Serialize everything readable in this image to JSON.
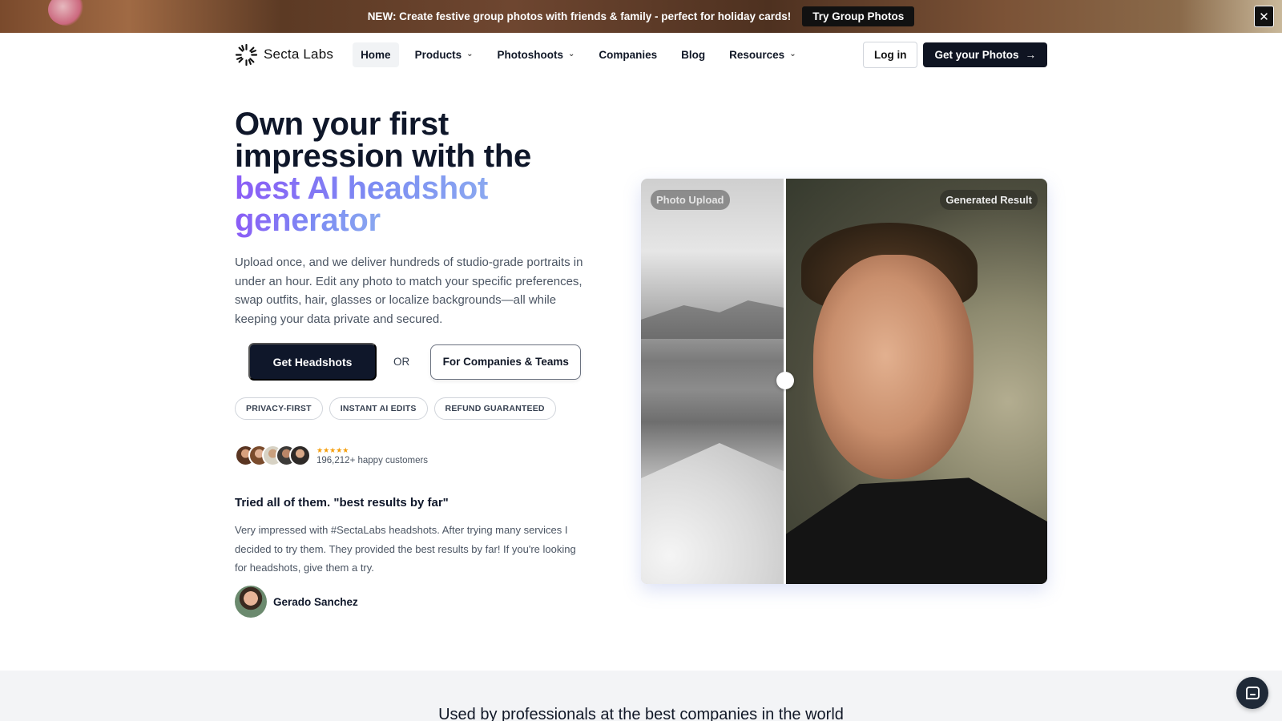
{
  "banner": {
    "text": "NEW: Create festive group photos with friends & family - perfect for holiday cards!",
    "button": "Try Group Photos",
    "close_glyph": "✕"
  },
  "nav": {
    "brand": "Secta Labs",
    "items": [
      {
        "label": "Home",
        "active": true,
        "dropdown": false
      },
      {
        "label": "Products",
        "dropdown": true
      },
      {
        "label": "Photoshoots",
        "dropdown": true
      },
      {
        "label": "Companies",
        "dropdown": false
      },
      {
        "label": "Blog",
        "dropdown": false
      },
      {
        "label": "Resources",
        "dropdown": true
      }
    ],
    "login": "Log in",
    "cta": "Get your Photos",
    "cta_arrow": "→"
  },
  "hero": {
    "title_line1": "Own your first",
    "title_line2": "impression with the",
    "title_grad1": "best AI headshot",
    "title_grad2": "generator",
    "description": "Upload once, and we deliver hundreds of studio-grade portraits in under an hour. Edit any photo to match your specific preferences, swap outfits, hair, glasses or localize backgrounds—all while keeping your data private and secured.",
    "primary_cta": "Get Headshots",
    "or_text": "OR",
    "secondary_cta": "For Companies & Teams",
    "tags": [
      "PRIVACY-FIRST",
      "INSTANT AI EDITS",
      "REFUND GUARANTEED"
    ],
    "stars": "★★★★★",
    "rating": 5,
    "customers": "196,212+ happy customers"
  },
  "testimonial": {
    "title": "Tried all of them. \"best results by far\"",
    "body": "Very impressed with #SectaLabs headshots. After trying many services I decided to try them. They provided the best results by far! If you're looking for headshots, give them a try.",
    "author": "Gerado Sanchez"
  },
  "comparison": {
    "left_label": "Photo Upload",
    "right_label": "Generated Result"
  },
  "footer_band": {
    "title": "Used by professionals at the best companies in the world"
  },
  "colors": {
    "brand_dark": "#0f172a",
    "gradient_start": "#8b5cf6",
    "gradient_end": "#8aa8f0",
    "star": "#f59e0b"
  },
  "icons": [
    "close-icon",
    "logo-spinner-icon",
    "chevron-down-icon",
    "arrow-right-icon",
    "chat-icon"
  ]
}
